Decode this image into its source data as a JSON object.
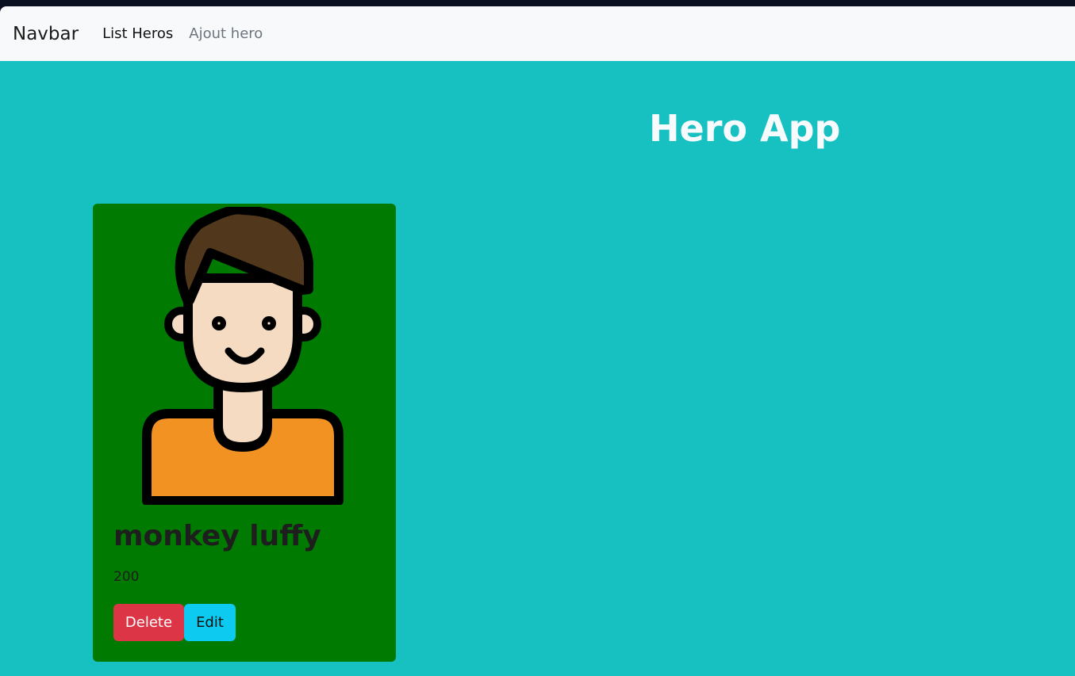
{
  "navbar": {
    "brand": "Navbar",
    "links": [
      {
        "label": "List Heros",
        "active": true
      },
      {
        "label": "Ajout hero",
        "active": false
      }
    ]
  },
  "main": {
    "title": "Hero App",
    "background_color": "#17c1c1"
  },
  "hero_card": {
    "name": "monkey luffy",
    "power": "200",
    "avatar_icon": "boy-avatar-icon",
    "card_color": "#007a00",
    "delete_label": "Delete",
    "edit_label": "Edit"
  }
}
